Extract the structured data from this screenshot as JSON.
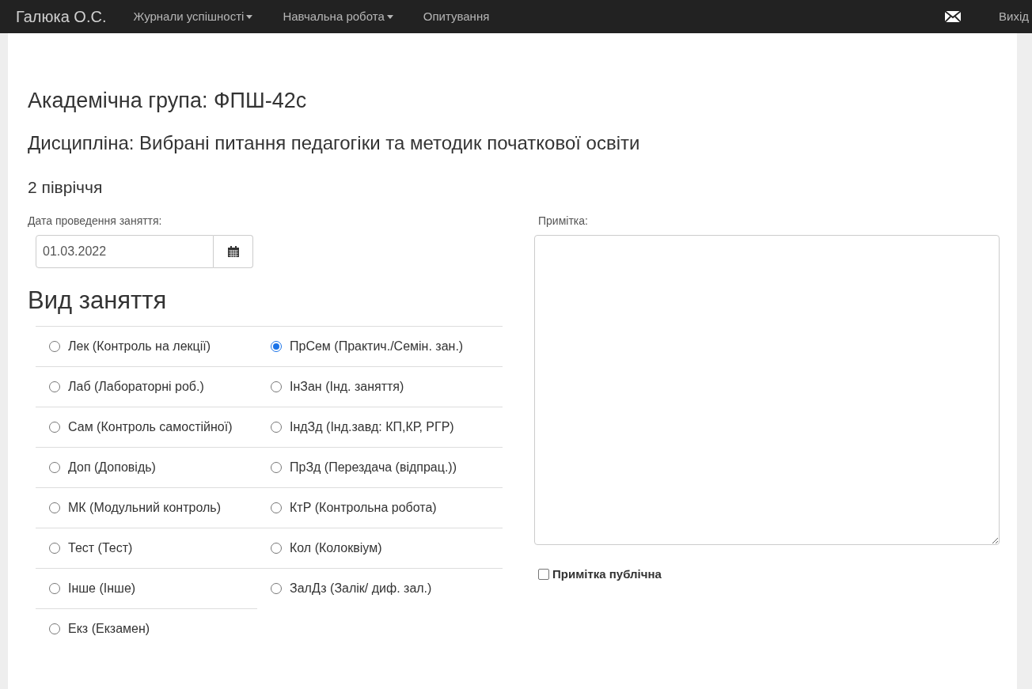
{
  "navbar": {
    "brand": "Галюка О.С.",
    "items": [
      {
        "label": "Журнали успішності",
        "dropdown": true
      },
      {
        "label": "Навчальна робота",
        "dropdown": true
      },
      {
        "label": "Опитування",
        "dropdown": false
      }
    ],
    "logout": "Вихід"
  },
  "group": "Академічна група: ФПШ-42с",
  "discipline": "Дисципліна: Вибрані питання педагогіки та методик початкової освіти",
  "semester": "2 півріччя",
  "date_field": {
    "label": "Дата проведення заняття:",
    "value": "01.03.2022"
  },
  "lesson_type": {
    "title": "Вид заняття",
    "options": [
      {
        "label": "Лек (Контроль на лекції)",
        "selected": false
      },
      {
        "label": "ПрСем (Практич./Семін. зан.)",
        "selected": true
      },
      {
        "label": "Лаб (Лабораторні роб.)",
        "selected": false
      },
      {
        "label": "ІнЗан (Інд. заняття)",
        "selected": false
      },
      {
        "label": "Сам (Контроль самостійної)",
        "selected": false
      },
      {
        "label": "ІндЗд (Інд.завд: КП,КР, РГР)",
        "selected": false
      },
      {
        "label": "Доп (Доповідь)",
        "selected": false
      },
      {
        "label": "ПрЗд (Перездача (відпрац.))",
        "selected": false
      },
      {
        "label": "МК (Модульний контроль)",
        "selected": false
      },
      {
        "label": "КтР (Контрольна робота)",
        "selected": false
      },
      {
        "label": "Тест (Тест)",
        "selected": false
      },
      {
        "label": "Кол (Колоквіум)",
        "selected": false
      },
      {
        "label": "Інше (Інше)",
        "selected": false
      },
      {
        "label": "ЗалДз (Залік/ диф. зал.)",
        "selected": false
      },
      {
        "label": "Екз (Екзамен)",
        "selected": false
      }
    ]
  },
  "note": {
    "label": "Примітка:",
    "public_label": "Примітка публічна",
    "public_checked": false
  }
}
